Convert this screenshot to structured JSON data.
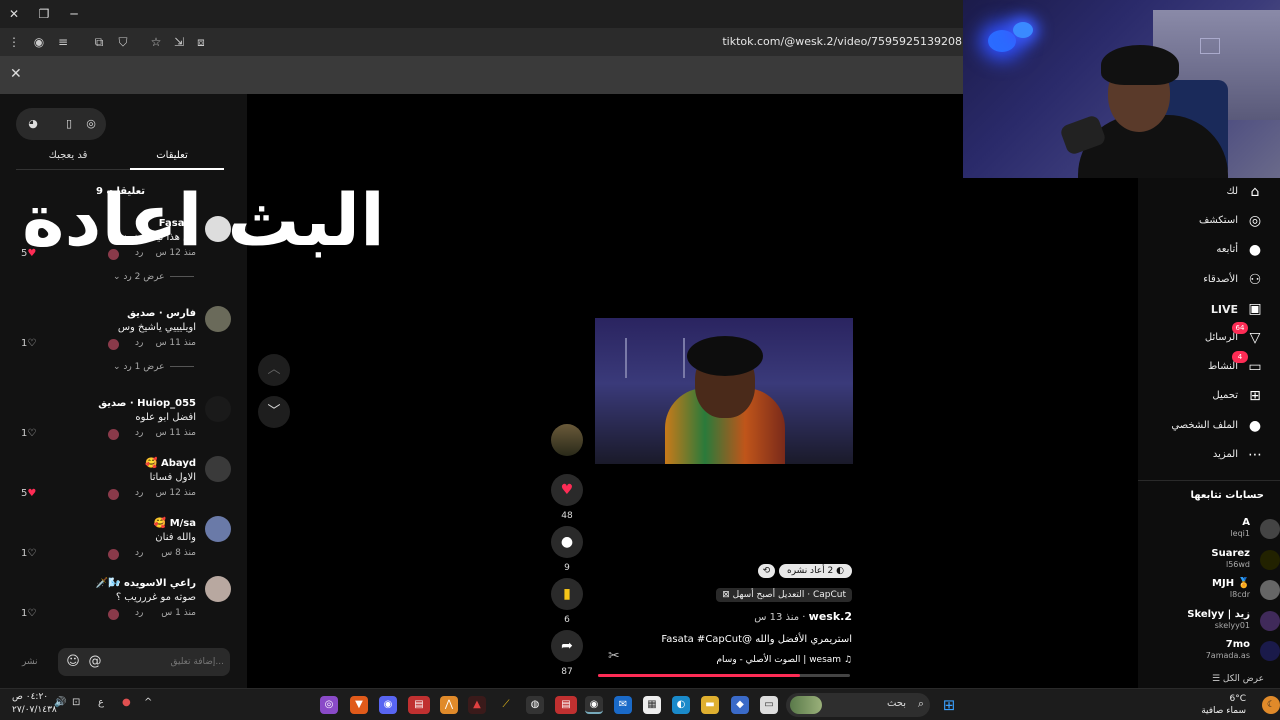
{
  "browser": {
    "url": "tiktok.com/@wesk.2/video/7595925139208"
  },
  "overlay": {
    "title": "البث اعادة"
  },
  "comments_panel": {
    "tabs": [
      "قد يعجبك",
      "تعليقات"
    ],
    "count_label": "9 تعليقات",
    "comments": [
      {
        "name": "Fasata",
        "text": "من هذا ليه لو نون",
        "time": "منذ 12 س",
        "reply": "رد",
        "likes": "5",
        "liked": true
      },
      {
        "name": "فارس · صديق",
        "text": "اويليييي ياشيخ وس",
        "time": "منذ 11 س",
        "reply": "رد",
        "likes": "1",
        "liked": false
      },
      {
        "name": "Huiop_055 · صديق",
        "text": "افضل ابو علوه",
        "time": "منذ 11 س",
        "reply": "رد",
        "likes": "1",
        "liked": false
      },
      {
        "name": "Abayd 🥰",
        "text": "الاول فساتا",
        "time": "منذ 12 س",
        "reply": "رد",
        "likes": "5",
        "liked": true
      },
      {
        "name": "M/sa 🥰",
        "text": "والله فنان",
        "time": "منذ 8 س",
        "reply": "رد",
        "likes": "1",
        "liked": false
      },
      {
        "name": "راعي الاسويده 🌬️🗡️",
        "text": "صوته مو غررريب ؟",
        "time": "منذ 1 س",
        "reply": "رد",
        "likes": "1",
        "liked": false
      }
    ],
    "replies_1": "عرض 2 رد",
    "replies_2": "عرض 1 رد",
    "input_placeholder": "إضافة تعليق...",
    "post_label": "نشر"
  },
  "video": {
    "repost_chip": "2 أعاد نشره",
    "capcut_chip": "CapCut · التعديل أصبح أسهل",
    "author": "wesk.2",
    "author_meta": " · منذ 13 س",
    "description": "استريمري الأفضل والله @Fasata #CapCut",
    "music": "wesam | الصوت الأصلي - وسام",
    "progress": 0.8
  },
  "actions": {
    "likes": "48",
    "comments": "9",
    "saves": "6",
    "shares": "87"
  },
  "right_nav": {
    "items": [
      {
        "label": "لك",
        "icon": "home-icon",
        "glyph": "⌂",
        "bold": false
      },
      {
        "label": "استكشف",
        "icon": "compass-icon",
        "glyph": "◎",
        "bold": false
      },
      {
        "label": "أتابعه",
        "icon": "following-icon",
        "glyph": "●",
        "bold": false
      },
      {
        "label": "الأصدقاء",
        "icon": "friends-icon",
        "glyph": "⚇",
        "bold": false
      },
      {
        "label": "LIVE",
        "icon": "live-icon",
        "glyph": "▣",
        "bold": true
      },
      {
        "label": "الرسائل",
        "icon": "messages-icon",
        "glyph": "▽",
        "bold": false,
        "badge": "64"
      },
      {
        "label": "النشاط",
        "icon": "activity-icon",
        "glyph": "▭",
        "bold": false,
        "badge": "4"
      },
      {
        "label": "تحميل",
        "icon": "upload-icon",
        "glyph": "⊞",
        "bold": false
      },
      {
        "label": "الملف الشخصي",
        "icon": "profile-icon",
        "glyph": "●",
        "bold": false
      },
      {
        "label": "المزيد",
        "icon": "more-icon",
        "glyph": "⋯",
        "bold": false
      }
    ],
    "following_title": "حسابات تتابعها",
    "accounts": [
      {
        "name": "A",
        "handle": "leqi1"
      },
      {
        "name": "Suarez",
        "handle": "l56wd"
      },
      {
        "name": "MJH 🏅",
        "handle": "l8cdr"
      },
      {
        "name": "Skelyy | زيد",
        "handle": "skelyy01"
      },
      {
        "name": "7mo",
        "handle": "7amada.as"
      }
    ],
    "see_all": "عرض الكل"
  },
  "taskbar": {
    "search_label": "بحث",
    "time": "٠٤:٢٠ ص",
    "date": "٢٧/٠٧/١٤٣٨",
    "lang": "ع",
    "weather_temp": "6°C",
    "weather_desc": "سماء صافية"
  }
}
